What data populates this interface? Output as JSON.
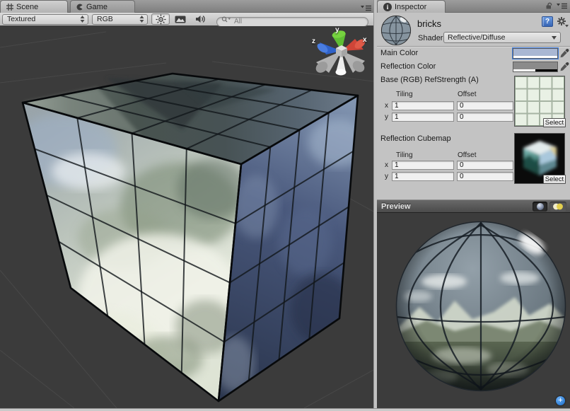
{
  "scene": {
    "tabs": {
      "scene": "Scene",
      "game": "Game"
    },
    "toolbar": {
      "render_mode": "Textured",
      "channel": "RGB",
      "search_placeholder": "All"
    },
    "gizmo": {
      "x": "x",
      "y": "y",
      "z": "z"
    },
    "background_color": "#3b3b3b"
  },
  "inspector": {
    "tab": "Inspector",
    "info_glyph": "i",
    "material": {
      "name": "bricks",
      "shader_label": "Shader",
      "shader_value": "Reflective/Diffuse",
      "help_glyph": "?"
    },
    "main_color": {
      "label": "Main Color",
      "hex": "#a9b7d3"
    },
    "reflection_color": {
      "label": "Reflection Color",
      "hex": "#8b8b8b"
    },
    "base_texture": {
      "label": "Base (RGB) RefStrength (A)",
      "tiling_header": "Tiling",
      "offset_header": "Offset",
      "x_label": "x",
      "y_label": "y",
      "tiling_x": "1",
      "offset_x": "0",
      "tiling_y": "1",
      "offset_y": "0",
      "select_label": "Select"
    },
    "reflection_cubemap": {
      "label": "Reflection Cubemap",
      "tiling_header": "Tiling",
      "offset_header": "Offset",
      "x_label": "x",
      "y_label": "y",
      "tiling_x": "1",
      "offset_x": "0",
      "tiling_y": "1",
      "offset_y": "0",
      "select_label": "Select"
    }
  },
  "preview": {
    "title": "Preview"
  }
}
